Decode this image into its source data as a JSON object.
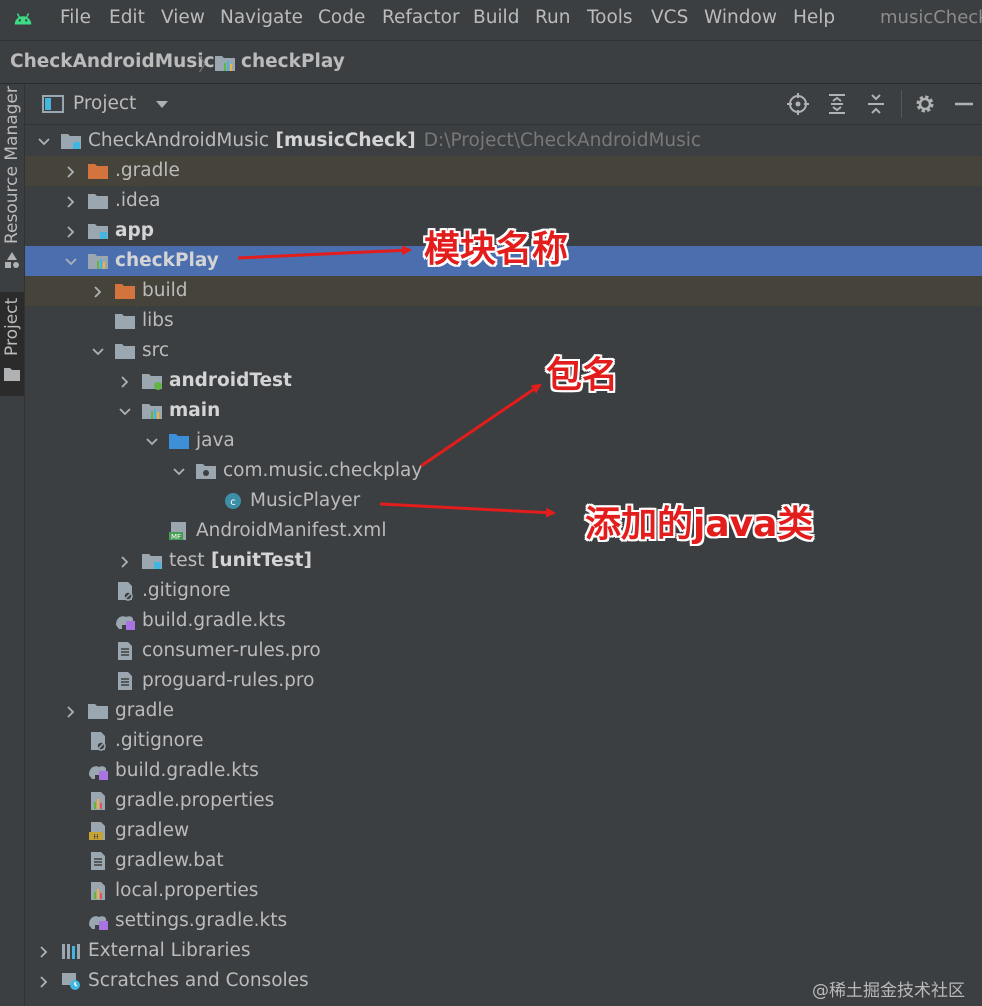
{
  "menubar": {
    "items": [
      "File",
      "Edit",
      "View",
      "Navigate",
      "Code",
      "Refactor",
      "Build",
      "Run",
      "Tools",
      "VCS",
      "Window",
      "Help"
    ],
    "title": "musicCheck"
  },
  "breadcrumb": {
    "project": "CheckAndroidMusic",
    "module": "checkPlay"
  },
  "side_tabs": {
    "resource_manager": "Resource Manager",
    "project": "Project"
  },
  "panel": {
    "title": "Project"
  },
  "tree": [
    {
      "label": "CheckAndroidMusic",
      "bold_suffix": "[musicCheck]",
      "path": "D:\\Project\\CheckAndroidMusic",
      "icon": "module-folder-icon",
      "expanded": true
    },
    {
      "label": ".gradle",
      "icon": "orange-folder-icon",
      "expanded": false
    },
    {
      "label": ".idea",
      "icon": "folder-icon",
      "expanded": false
    },
    {
      "label": "app",
      "icon": "module-folder-icon",
      "expanded": false
    },
    {
      "label": "checkPlay",
      "icon": "library-module-icon",
      "expanded": true
    },
    {
      "label": "build",
      "icon": "orange-folder-icon",
      "expanded": false
    },
    {
      "label": "libs",
      "icon": "folder-icon"
    },
    {
      "label": "src",
      "icon": "folder-icon",
      "expanded": true
    },
    {
      "label": "androidTest",
      "icon": "test-source-folder-icon",
      "expanded": false
    },
    {
      "label": "main",
      "icon": "source-root-icon",
      "expanded": true
    },
    {
      "label": "java",
      "icon": "blue-folder-icon",
      "expanded": true
    },
    {
      "label": "com.music.checkplay",
      "icon": "package-icon",
      "expanded": true
    },
    {
      "label": "MusicPlayer",
      "icon": "java-class-icon"
    },
    {
      "label": "AndroidManifest.xml",
      "icon": "manifest-icon"
    },
    {
      "label": "test",
      "bold_suffix": "[unitTest]",
      "icon": "test-folder-icon",
      "expanded": false
    },
    {
      "label": ".gitignore",
      "icon": "gitignore-icon"
    },
    {
      "label": "build.gradle.kts",
      "icon": "gradle-kts-icon"
    },
    {
      "label": "consumer-rules.pro",
      "icon": "text-file-icon"
    },
    {
      "label": "proguard-rules.pro",
      "icon": "text-file-icon"
    },
    {
      "label": "gradle",
      "icon": "folder-icon",
      "expanded": false
    },
    {
      "label": ".gitignore",
      "icon": "gitignore-icon"
    },
    {
      "label": "build.gradle.kts",
      "icon": "gradle-kts-icon"
    },
    {
      "label": "gradle.properties",
      "icon": "properties-icon"
    },
    {
      "label": "gradlew",
      "icon": "shell-script-icon"
    },
    {
      "label": "gradlew.bat",
      "icon": "text-file-icon"
    },
    {
      "label": "local.properties",
      "icon": "properties-icon"
    },
    {
      "label": "settings.gradle.kts",
      "icon": "gradle-kts-icon"
    },
    {
      "label": "External Libraries",
      "icon": "external-libraries-icon",
      "expanded": false
    },
    {
      "label": "Scratches and Consoles",
      "icon": "scratches-icon",
      "expanded": false
    }
  ],
  "annotations": {
    "module_name": "模块名称",
    "package_name": "包名",
    "added_java_class": "添加的java类"
  },
  "watermark": "@稀土掘金技术社区",
  "colors": {
    "background": "#3c3f41",
    "selection": "#4b6eaf",
    "excluded_row": "#45433a",
    "annotation_red": "#e31c1c"
  }
}
